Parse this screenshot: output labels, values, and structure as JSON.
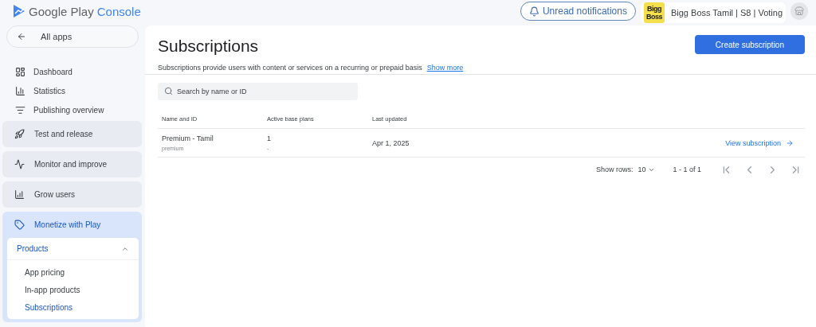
{
  "header": {
    "logo_text": "Google Play",
    "logo_accent": "Console",
    "notifications_button": "Unread notifications",
    "app_badge": "Bigg\nBoss",
    "app_name": "Bigg Boss Tamil | S8 | Voting"
  },
  "sidebar": {
    "back_button": "All apps",
    "items": [
      {
        "kind": "link",
        "label": "Dashboard"
      },
      {
        "kind": "link",
        "label": "Statistics"
      },
      {
        "kind": "link",
        "label": "Publishing overview"
      },
      {
        "kind": "section",
        "label": "Test and release",
        "expanded": false
      },
      {
        "kind": "section",
        "label": "Monitor and improve",
        "expanded": false
      },
      {
        "kind": "section",
        "label": "Grow users",
        "expanded": false
      },
      {
        "kind": "section",
        "label": "Monetize with Play",
        "expanded": true,
        "groups": [
          {
            "label": "Products",
            "expanded": true,
            "children": [
              {
                "label": "App pricing",
                "selected": false
              },
              {
                "label": "In-app products",
                "selected": false
              },
              {
                "label": "Subscriptions",
                "selected": true
              }
            ]
          }
        ]
      }
    ]
  },
  "page": {
    "title": "Subscriptions",
    "description": "Subscriptions provide users with content or services on a recurring or prepaid basis",
    "show_more": "Show more",
    "create_button": "Create subscription",
    "search": {
      "placeholder": "Search by name or ID"
    }
  },
  "table": {
    "columns": [
      "Name and ID",
      "Active base plans",
      "Last updated"
    ],
    "rows": [
      {
        "name": "Premium - Tamil",
        "id": "premium",
        "plans": "1",
        "plans_sub": "-",
        "updated": "Apr 1, 2025",
        "action": "View subscription"
      }
    ]
  },
  "pagination": {
    "label": "Show rows:",
    "rows": "10",
    "range": "1 - 1 of 1"
  }
}
